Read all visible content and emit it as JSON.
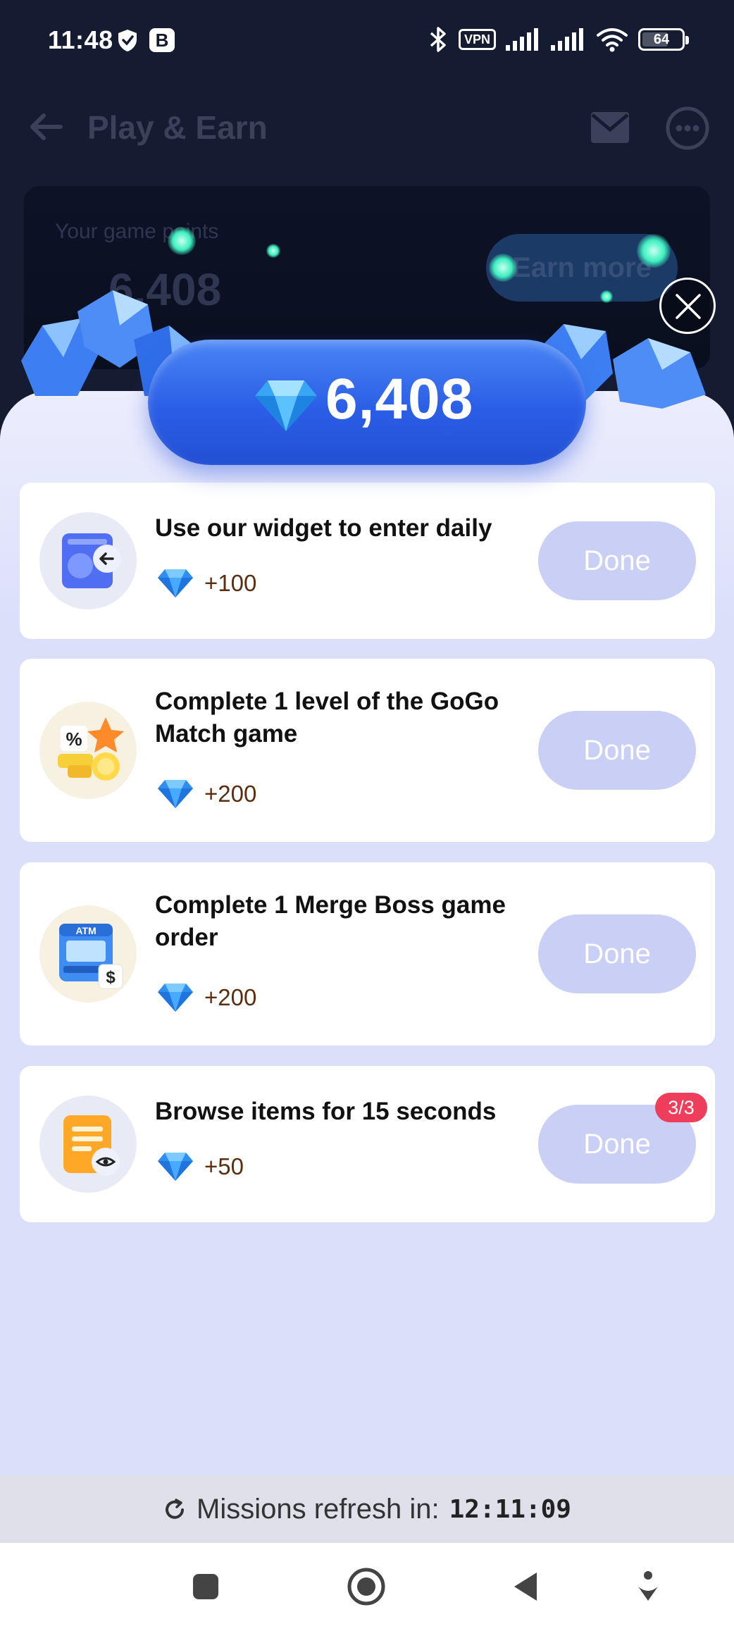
{
  "status_bar": {
    "time": "11:48",
    "b_badge": "B",
    "vpn": "VPN",
    "battery": "64"
  },
  "header": {
    "title": "Play & Earn"
  },
  "points_card": {
    "label": "Your game points",
    "value": "6,408",
    "earn_more": "Earn more"
  },
  "modal": {
    "points": "6,408",
    "missions": [
      {
        "title": "Use our widget to enter daily",
        "reward": "+100",
        "button": "Done",
        "icon": "widget-icon"
      },
      {
        "title": "Complete 1 level of the GoGo Match game",
        "reward": "+200",
        "button": "Done",
        "icon": "gogo-match-icon"
      },
      {
        "title": "Complete 1 Merge Boss game order",
        "reward": "+200",
        "button": "Done",
        "icon": "atm-icon"
      },
      {
        "title": "Browse items for 15 seconds",
        "reward": "+50",
        "button": "Done",
        "icon": "browse-icon",
        "badge": "3/3"
      }
    ],
    "refresh_label": "Missions refresh in:",
    "refresh_timer": "12:11:09"
  },
  "colors": {
    "accent_blue": "#2b5ee6",
    "modal_bg": "#dcdffa",
    "done_button": "#c9cff5",
    "badge_red": "#ef3e5c",
    "reward_text": "#5a2e10"
  }
}
